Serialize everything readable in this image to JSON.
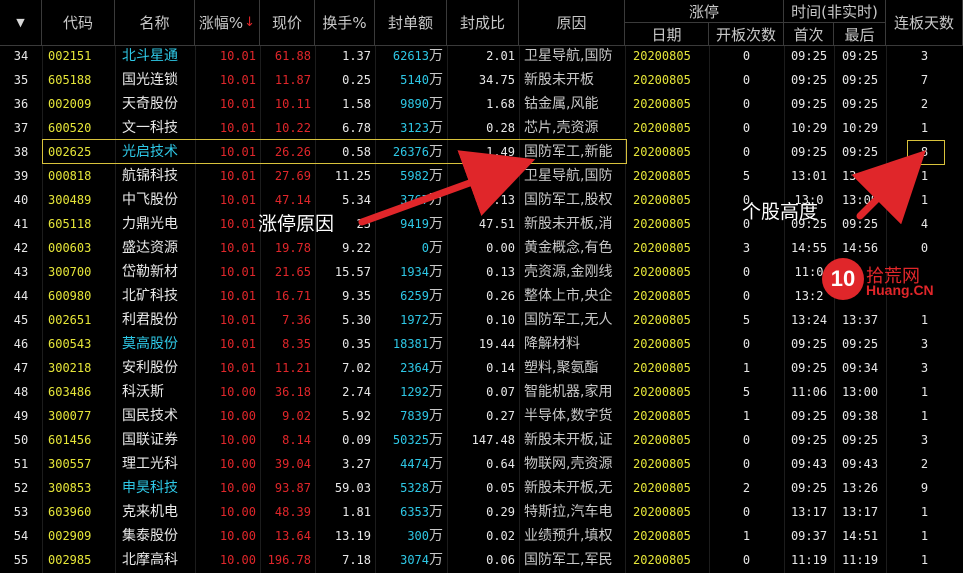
{
  "colors": {
    "background": "#000000",
    "red": "#e0262a",
    "yellow": "#e6e639",
    "cyan": "#2ec8e6",
    "white": "#e8e8e8",
    "grey": "#c8c8c8",
    "highlight_border": "#d8c23c",
    "arrow": "#e0262a"
  },
  "header": {
    "dropdown_icon": "▼",
    "code": "代码",
    "name": "名称",
    "pct": "涨幅%",
    "sort_arrow": "↓",
    "price": "现价",
    "turnover": "换手%",
    "seal_amount": "封单额",
    "seal_ratio": "封成比",
    "reason": "原因",
    "limit_up_group": "涨停",
    "date": "日期",
    "open_count": "开板次数",
    "time_group": "时间(非实时)",
    "first": "首次",
    "last": "最后",
    "streak": "连板天数"
  },
  "wan_unit": "万",
  "rows": [
    {
      "idx": "34",
      "code": "002151",
      "name": "北斗星通",
      "name_color": "cyan",
      "pct": "10.01",
      "price": "61.88",
      "turnover": "1.37",
      "seal": "62613",
      "ratio": "2.01",
      "reason": "卫星导航,国防",
      "date": "20200805",
      "opens": "0",
      "first": "09:25",
      "last": "09:25",
      "streak": "3"
    },
    {
      "idx": "35",
      "code": "605188",
      "name": "国光连锁",
      "name_color": "white",
      "pct": "10.01",
      "price": "11.87",
      "turnover": "0.25",
      "seal": "5140",
      "ratio": "34.75",
      "reason": "新股未开板",
      "date": "20200805",
      "opens": "0",
      "first": "09:25",
      "last": "09:25",
      "streak": "7"
    },
    {
      "idx": "36",
      "code": "002009",
      "name": "天奇股份",
      "name_color": "white",
      "pct": "10.01",
      "price": "10.11",
      "turnover": "1.58",
      "seal": "9890",
      "ratio": "1.68",
      "reason": "钴金属,风能",
      "date": "20200805",
      "opens": "0",
      "first": "09:25",
      "last": "09:25",
      "streak": "2"
    },
    {
      "idx": "37",
      "code": "600520",
      "name": "文一科技",
      "name_color": "white",
      "pct": "10.01",
      "price": "10.22",
      "turnover": "6.78",
      "seal": "3123",
      "ratio": "0.28",
      "reason": "芯片,壳资源",
      "date": "20200805",
      "opens": "0",
      "first": "10:29",
      "last": "10:29",
      "streak": "1"
    },
    {
      "idx": "38",
      "code": "002625",
      "name": "光启技术",
      "name_color": "cyan",
      "pct": "10.01",
      "price": "26.26",
      "turnover": "0.58",
      "seal": "26376",
      "ratio": "1.49",
      "reason": "国防军工,新能",
      "date": "20200805",
      "opens": "0",
      "first": "09:25",
      "last": "09:25",
      "streak": "8"
    },
    {
      "idx": "39",
      "code": "000818",
      "name": "航锦科技",
      "name_color": "white",
      "pct": "10.01",
      "price": "27.69",
      "turnover": "11.25",
      "seal": "5982",
      "ratio": "0.0",
      "reason": "卫星导航,国防",
      "date": "20200805",
      "opens": "5",
      "first": "13:01",
      "last": "13:37",
      "streak": "1"
    },
    {
      "idx": "40",
      "code": "300489",
      "name": "中飞股份",
      "name_color": "white",
      "pct": "10.01",
      "price": "47.14",
      "turnover": "5.34",
      "seal": "3767",
      "ratio": "0.13",
      "reason": "国防军工,股权",
      "date": "20200805",
      "opens": "0",
      "first": "13:0",
      "last": "13:09",
      "streak": "1"
    },
    {
      "idx": "41",
      "code": "605118",
      "name": "力鼎光电",
      "name_color": "white",
      "pct": "10.01",
      "price": "",
      "turnover": "25",
      "seal": "9419",
      "ratio": "47.51",
      "reason": "新股未开板,消",
      "date": "20200805",
      "opens": "0",
      "first": "09:25",
      "last": "09:25",
      "streak": "4"
    },
    {
      "idx": "42",
      "code": "000603",
      "name": "盛达资源",
      "name_color": "white",
      "pct": "10.01",
      "price": "19.78",
      "turnover": "9.22",
      "seal": "0",
      "ratio": "0.00",
      "reason": "黄金概念,有色",
      "date": "20200805",
      "opens": "3",
      "first": "14:55",
      "last": "14:56",
      "streak": "0"
    },
    {
      "idx": "43",
      "code": "300700",
      "name": "岱勒新材",
      "name_color": "white",
      "pct": "10.01",
      "price": "21.65",
      "turnover": "15.57",
      "seal": "1934",
      "ratio": "0.13",
      "reason": "壳资源,金刚线",
      "date": "20200805",
      "opens": "0",
      "first": "11:0",
      "last": "",
      "streak": ""
    },
    {
      "idx": "44",
      "code": "600980",
      "name": "北矿科技",
      "name_color": "white",
      "pct": "10.01",
      "price": "16.71",
      "turnover": "9.35",
      "seal": "6259",
      "ratio": "0.26",
      "reason": "整体上市,央企",
      "date": "20200805",
      "opens": "0",
      "first": "13:2",
      "last": "",
      "streak": ""
    },
    {
      "idx": "45",
      "code": "002651",
      "name": "利君股份",
      "name_color": "white",
      "pct": "10.01",
      "price": "7.36",
      "turnover": "5.30",
      "seal": "1972",
      "ratio": "0.10",
      "reason": "国防军工,无人",
      "date": "20200805",
      "opens": "5",
      "first": "13:24",
      "last": "13:37",
      "streak": "1"
    },
    {
      "idx": "46",
      "code": "600543",
      "name": "莫高股份",
      "name_color": "cyan",
      "pct": "10.01",
      "price": "8.35",
      "turnover": "0.35",
      "seal": "18381",
      "ratio": "19.44",
      "reason": "降解材料",
      "date": "20200805",
      "opens": "0",
      "first": "09:25",
      "last": "09:25",
      "streak": "3"
    },
    {
      "idx": "47",
      "code": "300218",
      "name": "安利股份",
      "name_color": "white",
      "pct": "10.01",
      "price": "11.21",
      "turnover": "7.02",
      "seal": "2364",
      "ratio": "0.14",
      "reason": "塑料,聚氨酯",
      "date": "20200805",
      "opens": "1",
      "first": "09:25",
      "last": "09:34",
      "streak": "3"
    },
    {
      "idx": "48",
      "code": "603486",
      "name": "科沃斯",
      "name_color": "white",
      "pct": "10.00",
      "price": "36.18",
      "turnover": "2.74",
      "seal": "1292",
      "ratio": "0.07",
      "reason": "智能机器,家用",
      "date": "20200805",
      "opens": "5",
      "first": "11:06",
      "last": "13:00",
      "streak": "1"
    },
    {
      "idx": "49",
      "code": "300077",
      "name": "国民技术",
      "name_color": "white",
      "pct": "10.00",
      "price": "9.02",
      "turnover": "5.92",
      "seal": "7839",
      "ratio": "0.27",
      "reason": "半导体,数字货",
      "date": "20200805",
      "opens": "1",
      "first": "09:25",
      "last": "09:38",
      "streak": "1"
    },
    {
      "idx": "50",
      "code": "601456",
      "name": "国联证券",
      "name_color": "white",
      "pct": "10.00",
      "price": "8.14",
      "turnover": "0.09",
      "seal": "50325",
      "ratio": "147.48",
      "reason": "新股未开板,证",
      "date": "20200805",
      "opens": "0",
      "first": "09:25",
      "last": "09:25",
      "streak": "3"
    },
    {
      "idx": "51",
      "code": "300557",
      "name": "理工光科",
      "name_color": "white",
      "pct": "10.00",
      "price": "39.04",
      "turnover": "3.27",
      "seal": "4474",
      "ratio": "0.64",
      "reason": "物联网,壳资源",
      "date": "20200805",
      "opens": "0",
      "first": "09:43",
      "last": "09:43",
      "streak": "2"
    },
    {
      "idx": "52",
      "code": "300853",
      "name": "申昊科技",
      "name_color": "cyan",
      "pct": "10.00",
      "price": "93.87",
      "turnover": "59.03",
      "seal": "5328",
      "ratio": "0.05",
      "reason": "新股未开板,无",
      "date": "20200805",
      "opens": "2",
      "first": "09:25",
      "last": "13:26",
      "streak": "9"
    },
    {
      "idx": "53",
      "code": "603960",
      "name": "克来机电",
      "name_color": "white",
      "pct": "10.00",
      "price": "48.39",
      "turnover": "1.81",
      "seal": "6353",
      "ratio": "0.29",
      "reason": "特斯拉,汽车电",
      "date": "20200805",
      "opens": "0",
      "first": "13:17",
      "last": "13:17",
      "streak": "1"
    },
    {
      "idx": "54",
      "code": "002909",
      "name": "集泰股份",
      "name_color": "white",
      "pct": "10.00",
      "price": "13.64",
      "turnover": "13.19",
      "seal": "300",
      "ratio": "0.02",
      "reason": "业绩预升,填权",
      "date": "20200805",
      "opens": "1",
      "first": "09:37",
      "last": "14:51",
      "streak": "1"
    },
    {
      "idx": "55",
      "code": "002985",
      "name": "北摩高科",
      "name_color": "white",
      "pct": "10.00",
      "price": "196.78",
      "turnover": "7.18",
      "seal": "3074",
      "ratio": "0.06",
      "reason": "国防军工,军民",
      "date": "20200805",
      "opens": "0",
      "first": "11:19",
      "last": "11:19",
      "streak": "1"
    }
  ],
  "annotations": {
    "reason_label": "涨停原因",
    "height_label": "个股高度"
  },
  "watermark": {
    "logo_text": "10",
    "cn_text": "拾荒网",
    "en_text": "Huang.CN"
  }
}
